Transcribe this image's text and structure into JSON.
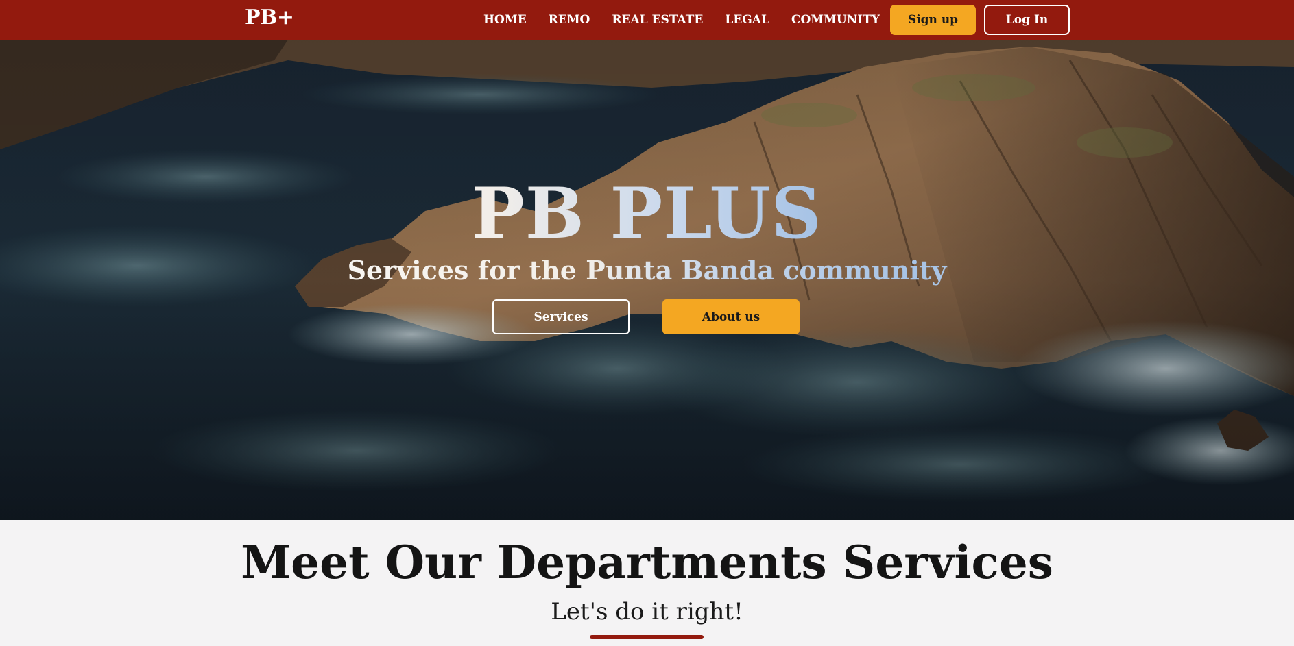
{
  "colors": {
    "nav_bg": "#931a0e",
    "accent": "#f4a722",
    "page_bg": "#f4f3f4",
    "heading": "#141414"
  },
  "nav": {
    "logo": "PB+",
    "links": [
      "HOME",
      "REMO",
      "REAL ESTATE",
      "LEGAL",
      "COMMUNITY"
    ],
    "signup_label": "Sign up",
    "login_label": "Log In"
  },
  "hero": {
    "background": "aerial-coastal-cliffs-ocean-waves",
    "title": "PB PLUS",
    "subtitle": "Services for the Punta Banda community",
    "services_label": "Services",
    "about_label": "About us"
  },
  "departments": {
    "title": "Meet Our Departments Services",
    "subtitle": "Let's do it right!"
  }
}
